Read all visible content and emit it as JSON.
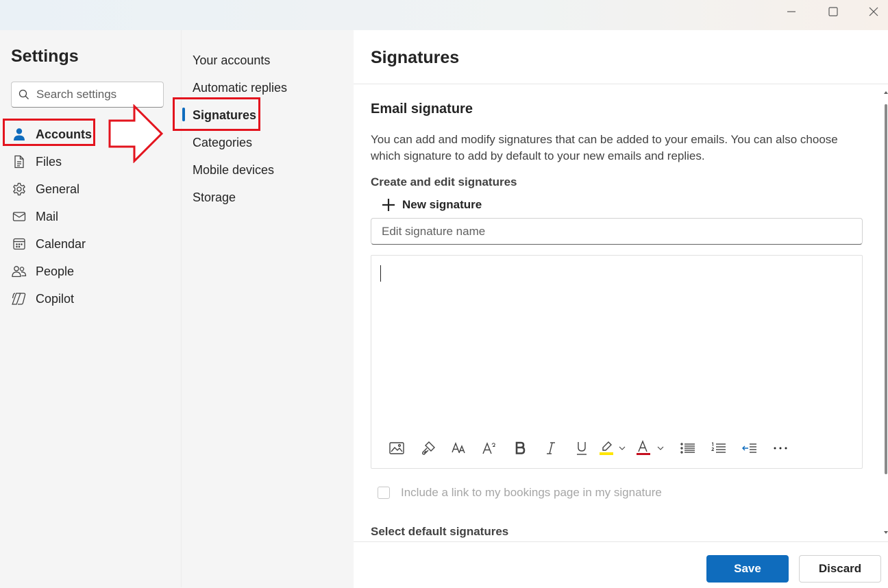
{
  "window": {
    "controls": [
      {
        "name": "minimize-icon"
      },
      {
        "name": "maximize-icon"
      },
      {
        "name": "close-icon"
      }
    ]
  },
  "settings": {
    "title": "Settings",
    "search_placeholder": "Search settings"
  },
  "nav": {
    "items": [
      {
        "label": "Accounts",
        "icon": "person-icon",
        "active": true
      },
      {
        "label": "Files",
        "icon": "file-icon"
      },
      {
        "label": "General",
        "icon": "gear-icon"
      },
      {
        "label": "Mail",
        "icon": "mail-icon"
      },
      {
        "label": "Calendar",
        "icon": "calendar-icon"
      },
      {
        "label": "People",
        "icon": "people-icon"
      },
      {
        "label": "Copilot",
        "icon": "copilot-icon"
      }
    ]
  },
  "subnav": {
    "items": [
      {
        "label": "Your accounts"
      },
      {
        "label": "Automatic replies"
      },
      {
        "label": "Signatures",
        "active": true
      },
      {
        "label": "Categories"
      },
      {
        "label": "Mobile devices"
      },
      {
        "label": "Storage"
      }
    ]
  },
  "content": {
    "title": "Signatures",
    "section_heading": "Email signature",
    "description": "You can add and modify signatures that can be added to your emails. You can also choose which signature to add by default to your new emails and replies.",
    "create_heading": "Create and edit signatures",
    "new_signature_label": "New signature",
    "name_placeholder": "Edit signature name",
    "bookings_label": "Include a link to my bookings page in my signature",
    "default_heading": "Select default signatures",
    "save_label": "Save",
    "discard_label": "Discard",
    "toolbar": [
      "insert-picture-icon",
      "format-painter-icon",
      "font-size-icon",
      "superscript-icon",
      "bold-icon",
      "italic-icon",
      "underline-icon",
      "highlight-icon",
      "font-color-icon",
      "bullets-icon",
      "numbering-icon",
      "decrease-indent-icon",
      "more-options-icon"
    ]
  },
  "colors": {
    "accent": "#0f6cbd",
    "annotation": "#e3141e",
    "highlight": "#ffe600",
    "font_color": "#c50f1f"
  }
}
